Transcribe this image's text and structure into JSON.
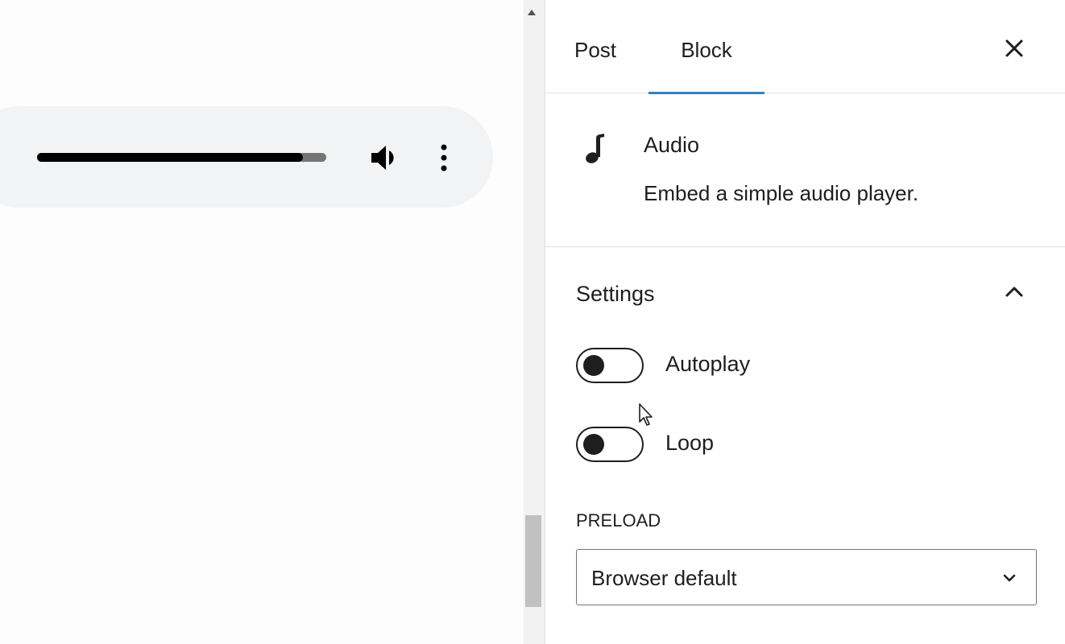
{
  "audio_player": {
    "progress": 0.92
  },
  "sidebar": {
    "tabs": [
      {
        "label": "Post",
        "active": false
      },
      {
        "label": "Block",
        "active": true
      }
    ]
  },
  "block_card": {
    "title": "Audio",
    "description": "Embed a simple audio player."
  },
  "settings": {
    "title": "Settings",
    "expanded": true,
    "autoplay": {
      "label": "Autoplay",
      "checked": false
    },
    "loop": {
      "label": "Loop",
      "checked": false
    },
    "preload": {
      "label": "Preload",
      "value": "Browser default"
    }
  },
  "colors": {
    "accent": "#3582c4",
    "text": "#1e1e1e",
    "player_background": "#f1f3f4",
    "divider": "#e0e0e0"
  },
  "icons": {
    "volume": "volume-icon",
    "more": "more-vertical-icon",
    "close": "close-icon",
    "block": "music-note-icon",
    "collapse": "chevron-up-icon",
    "select": "chevron-down-icon"
  }
}
